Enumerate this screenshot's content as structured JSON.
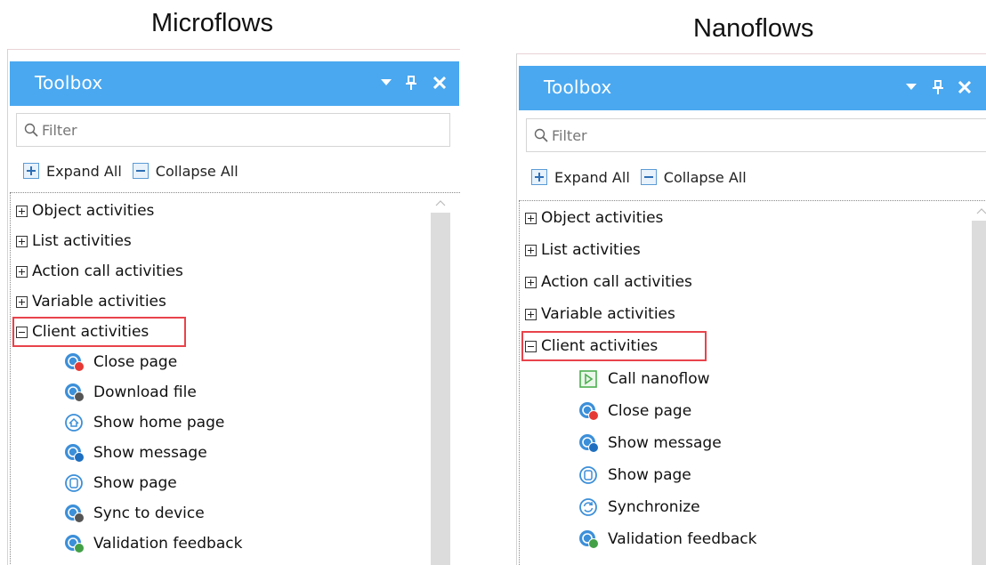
{
  "headings": {
    "left": "Microflows",
    "right": "Nanoflows"
  },
  "colors": {
    "titlebar": "#4aa8f0",
    "highlight": "#e8434b",
    "icon_blue": "#3c8fd9",
    "badge_red": "#e53935",
    "badge_green": "#43a047",
    "badge_dark": "#555555",
    "nanoflow_green": "#4caf50"
  },
  "panels": [
    {
      "title": "Toolbox",
      "filter_placeholder": "Filter",
      "expand_all": "Expand All",
      "collapse_all": "Collapse All",
      "categories": [
        {
          "label": "Object activities",
          "expanded": false
        },
        {
          "label": "List activities",
          "expanded": false
        },
        {
          "label": "Action call activities",
          "expanded": false
        },
        {
          "label": "Variable activities",
          "expanded": false
        },
        {
          "label": "Client activities",
          "expanded": true
        }
      ],
      "items": [
        {
          "label": "Close page",
          "icon": "close-page-icon"
        },
        {
          "label": "Download file",
          "icon": "download-file-icon"
        },
        {
          "label": "Show home page",
          "icon": "show-home-page-icon"
        },
        {
          "label": "Show message",
          "icon": "show-message-icon"
        },
        {
          "label": "Show page",
          "icon": "show-page-icon"
        },
        {
          "label": "Sync to device",
          "icon": "sync-to-device-icon"
        },
        {
          "label": "Validation feedback",
          "icon": "validation-feedback-icon"
        }
      ]
    },
    {
      "title": "Toolbox",
      "filter_placeholder": "Filter",
      "expand_all": "Expand All",
      "collapse_all": "Collapse All",
      "categories": [
        {
          "label": "Object activities",
          "expanded": false
        },
        {
          "label": "List activities",
          "expanded": false
        },
        {
          "label": "Action call activities",
          "expanded": false
        },
        {
          "label": "Variable activities",
          "expanded": false
        },
        {
          "label": "Client activities",
          "expanded": true
        }
      ],
      "items": [
        {
          "label": "Call nanoflow",
          "icon": "call-nanoflow-icon"
        },
        {
          "label": "Close page",
          "icon": "close-page-icon"
        },
        {
          "label": "Show message",
          "icon": "show-message-icon"
        },
        {
          "label": "Show page",
          "icon": "show-page-icon"
        },
        {
          "label": "Synchronize",
          "icon": "synchronize-icon"
        },
        {
          "label": "Validation feedback",
          "icon": "validation-feedback-icon"
        }
      ]
    }
  ]
}
